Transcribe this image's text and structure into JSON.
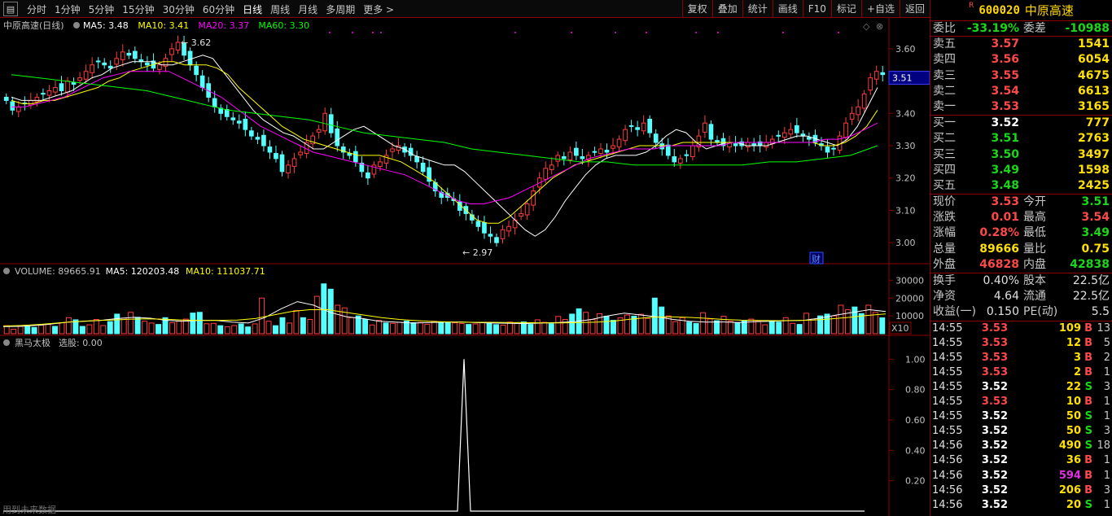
{
  "toolbar": {
    "periods": [
      "分时",
      "1分钟",
      "5分钟",
      "15分钟",
      "30分钟",
      "60分钟",
      "日线",
      "周线",
      "月线",
      "多周期",
      "更多 >"
    ],
    "active_period": "日线",
    "actions": [
      "复权",
      "叠加",
      "统计",
      "画线",
      "F10",
      "标记",
      "+自选",
      "返回"
    ]
  },
  "stock": {
    "code": "600020",
    "name": "中原高速",
    "badge": "R"
  },
  "chart_data": [
    {
      "type": "candlestick",
      "title": "中原高速(日线)",
      "legend": [
        {
          "label": "MA5: 3.48",
          "color": "#ffffff"
        },
        {
          "label": "MA10: 3.41",
          "color": "#ffff00"
        },
        {
          "label": "MA20: 3.37",
          "color": "#ff00ff"
        },
        {
          "label": "MA60: 3.30",
          "color": "#00ff00"
        }
      ],
      "y_ticks": [
        "3.60",
        "3.50",
        "3.40",
        "3.30",
        "3.20",
        "3.10",
        "3.00"
      ],
      "ylim": [
        2.95,
        3.64
      ],
      "current_price_tag": "3.51",
      "annotations": {
        "high_label": "3.62",
        "low_label": "2.97",
        "badge": "财"
      },
      "close_series": [
        3.44,
        3.41,
        3.42,
        3.43,
        3.44,
        3.45,
        3.46,
        3.47,
        3.48,
        3.47,
        3.5,
        3.49,
        3.51,
        3.53,
        3.55,
        3.56,
        3.55,
        3.54,
        3.57,
        3.59,
        3.58,
        3.57,
        3.56,
        3.55,
        3.54,
        3.55,
        3.57,
        3.6,
        3.62,
        3.58,
        3.55,
        3.52,
        3.48,
        3.45,
        3.42,
        3.4,
        3.39,
        3.38,
        3.37,
        3.35,
        3.33,
        3.32,
        3.3,
        3.28,
        3.26,
        3.22,
        3.24,
        3.26,
        3.28,
        3.31,
        3.33,
        3.35,
        3.4,
        3.34,
        3.3,
        3.28,
        3.27,
        3.25,
        3.22,
        3.2,
        3.24,
        3.25,
        3.27,
        3.29,
        3.3,
        3.28,
        3.27,
        3.25,
        3.22,
        3.19,
        3.16,
        3.14,
        3.14,
        3.13,
        3.1,
        3.09,
        3.07,
        3.05,
        3.03,
        3.02,
        3.0,
        3.04,
        3.05,
        3.07,
        3.09,
        3.12,
        3.16,
        3.2,
        3.23,
        3.24,
        3.27,
        3.26,
        3.28,
        3.27,
        3.26,
        3.27,
        3.28,
        3.29,
        3.28,
        3.3,
        3.32,
        3.35,
        3.36,
        3.35,
        3.37,
        3.34,
        3.31,
        3.29,
        3.27,
        3.25,
        3.26,
        3.27,
        3.3,
        3.33,
        3.37,
        3.32,
        3.31,
        3.3,
        3.31,
        3.3,
        3.3,
        3.31,
        3.3,
        3.3,
        3.31,
        3.32,
        3.33,
        3.34,
        3.35,
        3.34,
        3.33,
        3.32,
        3.31,
        3.3,
        3.28,
        3.29,
        3.33,
        3.37,
        3.4,
        3.42,
        3.46,
        3.51,
        3.53,
        3.52
      ],
      "ma_series": [
        {
          "name": "MA5",
          "color": "#ffffff",
          "values": [
            3.45,
            3.44,
            3.44,
            3.44,
            3.45,
            3.46,
            3.47,
            3.49,
            3.51,
            3.52,
            3.54,
            3.55,
            3.56,
            3.56,
            3.56,
            3.55,
            3.55,
            3.56,
            3.57,
            3.58,
            3.57,
            3.53,
            3.49,
            3.45,
            3.41,
            3.38,
            3.36,
            3.34,
            3.33,
            3.31,
            3.29,
            3.29,
            3.31,
            3.33,
            3.35,
            3.36,
            3.34,
            3.32,
            3.3,
            3.29,
            3.27,
            3.26,
            3.25,
            3.24,
            3.24,
            3.22,
            3.19,
            3.16,
            3.13,
            3.1,
            3.07,
            3.04,
            3.02,
            3.04,
            3.08,
            3.13,
            3.17,
            3.21,
            3.24,
            3.26,
            3.27,
            3.27,
            3.27,
            3.28,
            3.3,
            3.33,
            3.35,
            3.34,
            3.31,
            3.29,
            3.3,
            3.31,
            3.31,
            3.3,
            3.3,
            3.3,
            3.31,
            3.32,
            3.33,
            3.33,
            3.32,
            3.31,
            3.3,
            3.32,
            3.36,
            3.42,
            3.48
          ]
        },
        {
          "name": "MA10",
          "color": "#ffff00",
          "values": [
            3.44,
            3.43,
            3.43,
            3.44,
            3.44,
            3.45,
            3.46,
            3.47,
            3.48,
            3.5,
            3.51,
            3.53,
            3.54,
            3.55,
            3.56,
            3.56,
            3.55,
            3.55,
            3.55,
            3.54,
            3.52,
            3.48,
            3.45,
            3.42,
            3.39,
            3.36,
            3.34,
            3.32,
            3.31,
            3.3,
            3.29,
            3.28,
            3.27,
            3.27,
            3.27,
            3.26,
            3.25,
            3.23,
            3.21,
            3.19,
            3.16,
            3.13,
            3.1,
            3.07,
            3.06,
            3.06,
            3.08,
            3.11,
            3.14,
            3.17,
            3.2,
            3.22,
            3.24,
            3.25,
            3.26,
            3.27,
            3.28,
            3.29,
            3.3,
            3.3,
            3.3,
            3.3,
            3.31,
            3.31,
            3.31,
            3.31,
            3.31,
            3.31,
            3.31,
            3.31,
            3.31,
            3.31,
            3.31,
            3.31,
            3.31,
            3.3,
            3.3,
            3.31,
            3.33,
            3.36,
            3.41
          ]
        },
        {
          "name": "MA20",
          "color": "#ff00ff",
          "values": [
            3.42,
            3.42,
            3.43,
            3.44,
            3.45,
            3.47,
            3.49,
            3.51,
            3.52,
            3.53,
            3.53,
            3.53,
            3.53,
            3.51,
            3.49,
            3.47,
            3.45,
            3.42,
            3.39,
            3.36,
            3.34,
            3.32,
            3.3,
            3.28,
            3.27,
            3.26,
            3.25,
            3.24,
            3.23,
            3.22,
            3.21,
            3.19,
            3.17,
            3.15,
            3.13,
            3.12,
            3.12,
            3.13,
            3.14,
            3.16,
            3.18,
            3.2,
            3.22,
            3.24,
            3.26,
            3.27,
            3.28,
            3.29,
            3.29,
            3.29,
            3.3,
            3.3,
            3.3,
            3.3,
            3.3,
            3.31,
            3.31,
            3.31,
            3.31,
            3.31,
            3.31,
            3.31,
            3.32,
            3.32,
            3.33,
            3.35,
            3.37
          ]
        },
        {
          "name": "MA60",
          "color": "#00ff00",
          "values": [
            3.52,
            3.51,
            3.5,
            3.49,
            3.48,
            3.47,
            3.45,
            3.43,
            3.41,
            3.4,
            3.39,
            3.38,
            3.36,
            3.34,
            3.33,
            3.32,
            3.31,
            3.29,
            3.28,
            3.27,
            3.26,
            3.25,
            3.25,
            3.24,
            3.24,
            3.24,
            3.24,
            3.24,
            3.25,
            3.25,
            3.26,
            3.27,
            3.3
          ]
        }
      ]
    },
    {
      "type": "bar",
      "title": "VOLUME: 89665.91",
      "legend": [
        {
          "label": "MA5: 120203.48",
          "color": "#ffffff"
        },
        {
          "label": "MA10: 111037.71",
          "color": "#ffff00"
        }
      ],
      "y_ticks": [
        "30000",
        "20000",
        "10000"
      ],
      "ylim": [
        0,
        32000
      ],
      "unit_tag": "X10",
      "values": [
        4500,
        2500,
        4200,
        4000,
        3500,
        4800,
        5200,
        4100,
        6200,
        9000,
        7800,
        4100,
        5000,
        8000,
        4600,
        6800,
        11000,
        8700,
        12000,
        9200,
        7000,
        6000,
        5200,
        9000,
        6200,
        7000,
        8200,
        11600,
        12000,
        5600,
        5800,
        4500,
        3900,
        4600,
        5500,
        3800,
        5500,
        20000,
        7000,
        4500,
        9000,
        6000,
        13000,
        9000,
        8000,
        21000,
        28000,
        25000,
        16000,
        14500,
        9000,
        10000,
        8000,
        4900,
        7500,
        6000,
        5800,
        6400,
        7100,
        6200,
        6300,
        5300,
        7000,
        6600,
        6400,
        6100,
        5700,
        5200,
        5500,
        6300,
        5800,
        5100,
        4800,
        6500,
        5800,
        6600,
        5200,
        7800,
        6400,
        5600,
        9700,
        8000,
        11000,
        14000,
        12000,
        8000,
        11200,
        9800,
        7500,
        8900,
        10500,
        9800,
        10900,
        8600,
        20000,
        15000,
        10000,
        6800,
        9000,
        6500,
        5700,
        11800,
        8300,
        7300,
        9800,
        7000,
        6200,
        7100,
        8200,
        7000,
        5000,
        7200,
        6500,
        9000,
        5800,
        5200,
        11500,
        8200,
        10000,
        11000,
        10000,
        16000,
        13500,
        15000,
        11300,
        16000,
        12000,
        8900
      ],
      "ma_series": [
        {
          "name": "MA5",
          "color": "#ffffff",
          "values": [
            4000,
            4100,
            4600,
            5500,
            6500,
            7000,
            7500,
            8500,
            9200,
            8700,
            7500,
            7000,
            7500,
            7500,
            6500,
            6000,
            9000,
            14000,
            18000,
            16000,
            12000,
            9500,
            8500,
            7000,
            6500,
            6000,
            6200,
            6500,
            6600,
            6200,
            6000,
            5800,
            5700,
            6000,
            6300,
            6800,
            8000,
            10000,
            11500,
            10500,
            9500,
            8000,
            7000,
            6500,
            6600,
            6300,
            6700,
            7000,
            7300,
            7500,
            8800,
            10500,
            12000,
            13500,
            12500
          ]
        },
        {
          "name": "MA10",
          "color": "#ffff00",
          "values": [
            4300,
            4600,
            5200,
            6000,
            6800,
            7300,
            7700,
            8100,
            8300,
            8100,
            7700,
            7400,
            7500,
            7700,
            8500,
            10500,
            12500,
            13500,
            13500,
            12000,
            10500,
            9000,
            8000,
            7300,
            6800,
            6500,
            6400,
            6400,
            6300,
            6200,
            6100,
            6100,
            6200,
            6500,
            7200,
            8300,
            9200,
            9500,
            9200,
            8700,
            8000,
            7600,
            7400,
            7300,
            7400,
            7700,
            8300,
            9200,
            10300,
            11100
          ]
        }
      ]
    },
    {
      "type": "line",
      "title": "黑马太极",
      "legend": [
        {
          "label": "选股: 0.00",
          "color": "#c0c0c0"
        }
      ],
      "y_ticks": [
        "1.00",
        "0.80",
        "0.60",
        "0.40",
        "0.20"
      ],
      "ylim": [
        0,
        1.05
      ],
      "spike_position": 0.5,
      "spike_value": 1.0,
      "watermark": "用到未来数据"
    }
  ],
  "quote": {
    "weibi": {
      "label": "委比",
      "value": "-33.19%",
      "label2": "委差",
      "value2": "-10988"
    },
    "sell": [
      {
        "label": "卖五",
        "price": "3.57",
        "vol": "1541"
      },
      {
        "label": "卖四",
        "price": "3.56",
        "vol": "6054"
      },
      {
        "label": "卖三",
        "price": "3.55",
        "vol": "4675"
      },
      {
        "label": "卖二",
        "price": "3.54",
        "vol": "6613"
      },
      {
        "label": "卖一",
        "price": "3.53",
        "vol": "3165"
      }
    ],
    "buy": [
      {
        "label": "买一",
        "price": "3.52",
        "vol": "777",
        "pc": "white"
      },
      {
        "label": "买二",
        "price": "3.51",
        "vol": "2763",
        "pc": "green"
      },
      {
        "label": "买三",
        "price": "3.50",
        "vol": "3497",
        "pc": "green"
      },
      {
        "label": "买四",
        "price": "3.49",
        "vol": "1598",
        "pc": "green"
      },
      {
        "label": "买五",
        "price": "3.48",
        "vol": "2425",
        "pc": "green"
      }
    ],
    "stats": [
      {
        "l1": "现价",
        "v1": "3.53",
        "c1": "red",
        "l2": "今开",
        "v2": "3.51",
        "c2": "green"
      },
      {
        "l1": "涨跌",
        "v1": "0.01",
        "c1": "red",
        "l2": "最高",
        "v2": "3.54",
        "c2": "red"
      },
      {
        "l1": "涨幅",
        "v1": "0.28%",
        "c1": "red",
        "l2": "最低",
        "v2": "3.49",
        "c2": "green"
      },
      {
        "l1": "总量",
        "v1": "89666",
        "c1": "yellow",
        "l2": "量比",
        "v2": "0.75",
        "c2": "yellow"
      },
      {
        "l1": "外盘",
        "v1": "46828",
        "c1": "red",
        "l2": "内盘",
        "v2": "42838",
        "c2": "green"
      }
    ],
    "stats2": [
      {
        "l1": "换手",
        "v1": "0.40%",
        "l2": "股本",
        "v2": "22.5亿"
      },
      {
        "l1": "净资",
        "v1": "4.64",
        "l2": "流通",
        "v2": "22.5亿"
      },
      {
        "l1": "收益(一)",
        "v1": "0.150",
        "l2": "PE(动)",
        "v2": "5.5"
      }
    ]
  },
  "ticks": [
    {
      "time": "14:55",
      "price": "3.53",
      "pc": "red",
      "vol": "109",
      "vc": "yellow",
      "bs": "B",
      "n": "13"
    },
    {
      "time": "14:55",
      "price": "3.53",
      "pc": "red",
      "vol": "12",
      "vc": "yellow",
      "bs": "B",
      "n": "5"
    },
    {
      "time": "14:55",
      "price": "3.53",
      "pc": "red",
      "vol": "3",
      "vc": "yellow",
      "bs": "B",
      "n": "2"
    },
    {
      "time": "14:55",
      "price": "3.53",
      "pc": "red",
      "vol": "2",
      "vc": "yellow",
      "bs": "B",
      "n": "1"
    },
    {
      "time": "14:55",
      "price": "3.52",
      "pc": "white",
      "vol": "22",
      "vc": "yellow",
      "bs": "S",
      "n": "3"
    },
    {
      "time": "14:55",
      "price": "3.53",
      "pc": "red",
      "vol": "10",
      "vc": "yellow",
      "bs": "B",
      "n": "1"
    },
    {
      "time": "14:55",
      "price": "3.52",
      "pc": "white",
      "vol": "50",
      "vc": "yellow",
      "bs": "S",
      "n": "1"
    },
    {
      "time": "14:55",
      "price": "3.52",
      "pc": "white",
      "vol": "50",
      "vc": "yellow",
      "bs": "S",
      "n": "3"
    },
    {
      "time": "14:56",
      "price": "3.52",
      "pc": "white",
      "vol": "490",
      "vc": "yellow",
      "bs": "S",
      "n": "18"
    },
    {
      "time": "14:56",
      "price": "3.52",
      "pc": "white",
      "vol": "36",
      "vc": "yellow",
      "bs": "B",
      "n": "1"
    },
    {
      "time": "14:56",
      "price": "3.52",
      "pc": "white",
      "vol": "594",
      "vc": "magenta",
      "bs": "B",
      "n": "1"
    },
    {
      "time": "14:56",
      "price": "3.52",
      "pc": "white",
      "vol": "206",
      "vc": "yellow",
      "bs": "B",
      "n": "3"
    },
    {
      "time": "14:56",
      "price": "3.52",
      "pc": "white",
      "vol": "20",
      "vc": "yellow",
      "bs": "S",
      "n": "1"
    }
  ],
  "colors": {
    "up": "#ff3c3c",
    "down": "#54ffff",
    "grid": "#8b0000"
  }
}
